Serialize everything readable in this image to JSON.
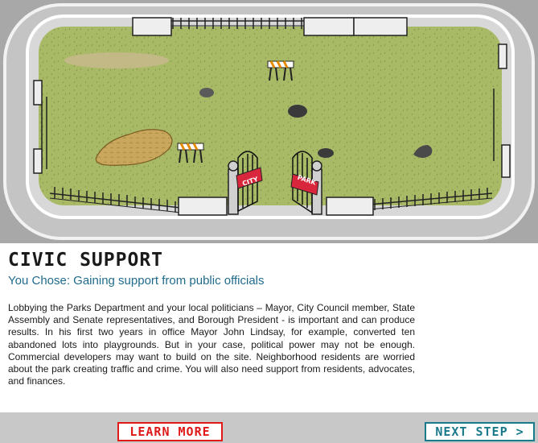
{
  "scene": {
    "gate_signs": {
      "left": "CITY",
      "right": "PARK"
    }
  },
  "panel": {
    "title": "CIVIC SUPPORT",
    "subtitle": "You Chose: Gaining support from public officials",
    "body": "Lobbying the Parks Department and your local politicians – Mayor, City Council member, State Assembly and Senate representatives, and Borough President - is important and can produce results. In his first two years in office Mayor John Lindsay, for example, converted ten abandoned lots into playgrounds. But in your case, political power may not be enough. Commercial developers may want to build on the site. Neighborhood residents are worried about the park creating traffic and crime. You will also need support from residents, advocates, and finances."
  },
  "footer": {
    "learn_more_label": "LEARN MORE",
    "next_step_label": "NEXT STEP >"
  },
  "colors": {
    "road": "#bdbdbd",
    "curb": "#e0e0e0",
    "grass": "#a6b763",
    "dirt": "#c9a85d",
    "sign_red": "#d8263c",
    "learn_more": "#e01818",
    "next_step": "#1a7a8c",
    "subtitle": "#1f6b8c"
  }
}
